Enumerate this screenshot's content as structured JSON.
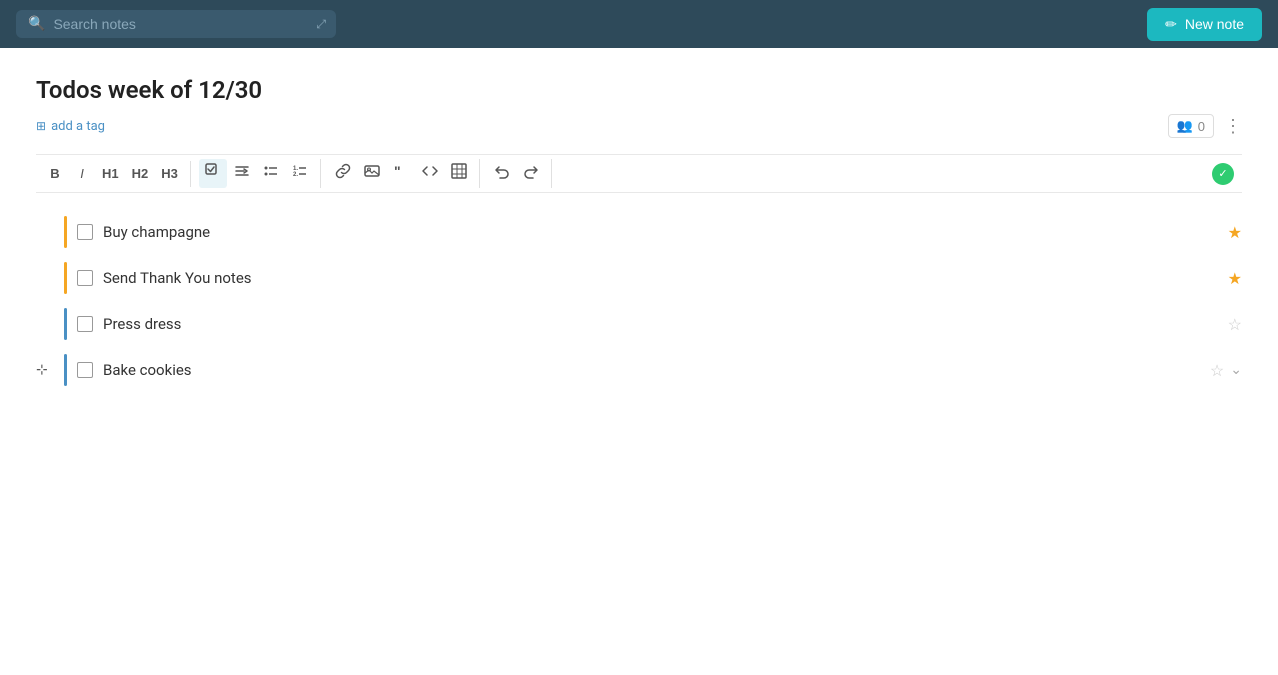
{
  "topbar": {
    "search_placeholder": "Search notes",
    "new_note_label": "New note",
    "expand_icon": "⤢"
  },
  "note": {
    "title": "Todos week of 12/30",
    "add_tag_label": "add a tag",
    "collab_count": "0",
    "toolbar": {
      "bold": "B",
      "italic": "I",
      "h1": "H1",
      "h2": "H2",
      "h3": "H3",
      "link_icon": "🔗",
      "image_icon": "🖼",
      "quote_icon": "❝",
      "code_icon": "<>",
      "table_icon": "⊞",
      "undo_icon": "↩",
      "redo_icon": "↪"
    },
    "todos": [
      {
        "id": 1,
        "text": "Buy champagne",
        "checked": false,
        "starred": true,
        "border": "orange"
      },
      {
        "id": 2,
        "text": "Send Thank You notes",
        "checked": false,
        "starred": true,
        "border": "orange"
      },
      {
        "id": 3,
        "text": "Press dress",
        "checked": false,
        "starred": false,
        "border": "blue"
      },
      {
        "id": 4,
        "text": "Bake cookies",
        "checked": false,
        "starred": false,
        "border": "blue",
        "active": true
      }
    ]
  },
  "icons": {
    "search": "🔍",
    "pencil": "✏",
    "tag": "⊞",
    "people": "👥",
    "more": "⋮",
    "drag": "⊹",
    "star_empty": "☆",
    "star_filled": "★",
    "chevron_down": "⌄",
    "check": "✓"
  },
  "colors": {
    "topbar_bg": "#2e4a5a",
    "accent_teal": "#1cb8c0",
    "orange_border": "#f5a623",
    "blue_border": "#4a90c4",
    "save_green": "#2ecc71"
  }
}
